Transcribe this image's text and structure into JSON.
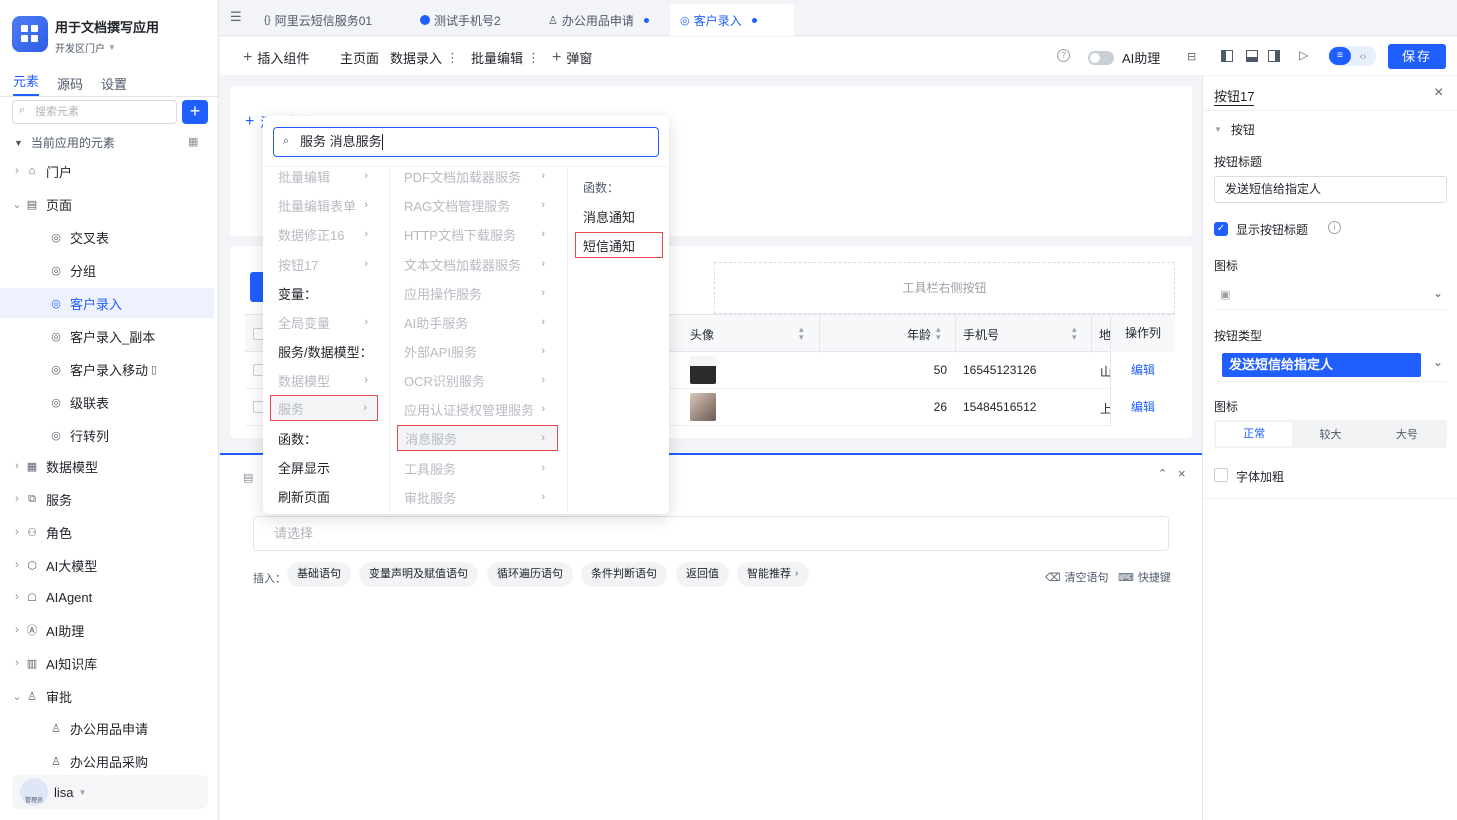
{
  "app": {
    "title": "用于文档撰写应用",
    "portal": "开发区门户"
  },
  "sidebar": {
    "tabs": [
      "元素",
      "源码",
      "设置"
    ],
    "search_placeholder": "搜索元素",
    "section_title": "当前应用的元素",
    "items": [
      {
        "label": "门户"
      },
      {
        "label": "页面"
      },
      {
        "label": "交叉表"
      },
      {
        "label": "分组"
      },
      {
        "label": "客户录入"
      },
      {
        "label": "客户录入_副本"
      },
      {
        "label": "客户录入移动"
      },
      {
        "label": "级联表"
      },
      {
        "label": "行转列"
      },
      {
        "label": "数据模型"
      },
      {
        "label": "服务"
      },
      {
        "label": "角色"
      },
      {
        "label": "AI大模型"
      },
      {
        "label": "AIAgent"
      },
      {
        "label": "AI助理"
      },
      {
        "label": "AI知识库"
      },
      {
        "label": "审批"
      },
      {
        "label": "办公用品申请"
      },
      {
        "label": "办公用品采购"
      }
    ],
    "user": {
      "name": "lisa",
      "role": "管理员"
    }
  },
  "tabs": [
    {
      "label": "阿里云短信服务01"
    },
    {
      "label": "测试手机号2"
    },
    {
      "label": "办公用品申请"
    },
    {
      "label": "客户录入"
    }
  ],
  "toolbar": {
    "insert": "插入组件",
    "home": "主页面",
    "data_entry": "数据录入",
    "batch_edit": "批量编辑",
    "popup": "弹窗",
    "ai_assist": "AI助理",
    "save": "保存"
  },
  "canvas": {
    "add_field": "添加字段",
    "toolbar_right": "工具栏右侧按钮",
    "columns": {
      "avatar": "头像",
      "age": "年龄",
      "phone": "手机号",
      "addr": "地",
      "actions": "操作列"
    },
    "rows": [
      {
        "age": "50",
        "phone": "16545123126",
        "addr": "山",
        "action": "编辑"
      },
      {
        "age": "26",
        "phone": "15484516512",
        "addr": "上",
        "action": "编辑"
      }
    ]
  },
  "popup": {
    "search_value": "服务 消息服务",
    "col1": [
      {
        "label": "批量编辑",
        "dim": true,
        "arrow": true
      },
      {
        "label": "批量编辑表单",
        "dim": true,
        "arrow": true
      },
      {
        "label": "数据修正16",
        "dim": true,
        "arrow": true
      },
      {
        "label": "按钮17",
        "dim": true,
        "arrow": true
      },
      {
        "label": "变量：",
        "dim": false,
        "arrow": false
      },
      {
        "label": "全局变量",
        "dim": true,
        "arrow": true
      },
      {
        "label": "服务/数据模型：",
        "dim": false,
        "arrow": false
      },
      {
        "label": "数据模型",
        "dim": true,
        "arrow": true
      },
      {
        "label": "服务",
        "dim": true,
        "arrow": true
      },
      {
        "label": "函数：",
        "dim": false,
        "arrow": false
      },
      {
        "label": "全屏显示",
        "dim": false,
        "arrow": false
      },
      {
        "label": "刷新页面",
        "dim": false,
        "arrow": false
      }
    ],
    "col2": [
      {
        "label": "PDF文档加载器服务"
      },
      {
        "label": "RAG文档管理服务"
      },
      {
        "label": "HTTP文档下载服务"
      },
      {
        "label": "文本文档加载器服务"
      },
      {
        "label": "应用操作服务"
      },
      {
        "label": "AI助手服务"
      },
      {
        "label": "外部API服务"
      },
      {
        "label": "OCR识别服务"
      },
      {
        "label": "应用认证授权管理服务"
      },
      {
        "label": "消息服务"
      },
      {
        "label": "工具服务"
      },
      {
        "label": "审批服务"
      }
    ],
    "col3": [
      {
        "label": "函数："
      },
      {
        "label": "消息通知"
      },
      {
        "label": "短信通知"
      }
    ]
  },
  "bottom": {
    "placeholder": "请选择",
    "insert_label": "插入：",
    "chips": [
      "基础语句",
      "变量声明及赋值语句",
      "循环遍历语句",
      "条件判断语句",
      "返回值",
      "智能推荐"
    ],
    "clear": "清空语句",
    "shortcut": "快捷键"
  },
  "rightpanel": {
    "title": "按钮17",
    "section": "按钮",
    "btn_title_label": "按钮标题",
    "btn_title_value": "发送短信给指定人",
    "show_title": "显示按钮标题",
    "icon_label": "图标",
    "btn_type_label": "按钮类型",
    "btn_type_value": "发送短信给指定人",
    "size_label": "图标",
    "sizes": [
      "正常",
      "较大",
      "大号"
    ],
    "bold_label": "字体加粗"
  },
  "colors": {
    "primary": "#1f5eff",
    "highlight": "#e5484d"
  }
}
